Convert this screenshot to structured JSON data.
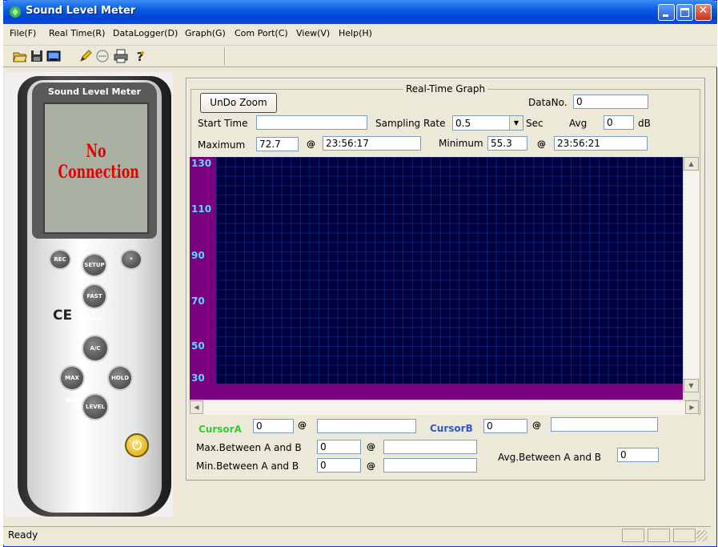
{
  "window": {
    "title": "Sound Level Meter"
  },
  "menu": [
    "File(F)",
    "Real Time(R)",
    "DataLogger(D)",
    "Graph(G)",
    "Com Port(C)",
    "View(V)",
    "Help(H)"
  ],
  "toolbar": {
    "icons": [
      "open-folder-icon",
      "save-icon",
      "monitor-icon",
      "pencil-icon",
      "circle-icon",
      "print-icon",
      "help-icon"
    ]
  },
  "device": {
    "label": "Sound Level Meter",
    "status": "No Connection",
    "buttons": {
      "rec": "REC",
      "setup": "SETUP",
      "light": "*",
      "fastslow": "FAST SLOW",
      "ac": "A/C",
      "maxmin": "MAX MIN",
      "hold": "HOLD",
      "level": "LEVEL"
    },
    "ce": "CE"
  },
  "graph": {
    "title": "Real-Time Graph",
    "undo_zoom": "UnDo Zoom",
    "datano_label": "DataNo.",
    "datano": "0",
    "start_time_label": "Start Time",
    "start_time": "",
    "sampling_label": "Sampling Rate",
    "sampling": "0.5",
    "sec_label": "Sec",
    "avg_label": "Avg",
    "avg": "0",
    "db_label": "dB",
    "maximum_label": "Maximum",
    "maximum": "72.7",
    "max_time": "23:56:17",
    "minimum_label": "Minimum",
    "minimum": "55.3",
    "min_time": "23:56:21",
    "at": "@",
    "yticks": [
      "130",
      "110",
      "90",
      "70",
      "50",
      "30"
    ]
  },
  "cursors": {
    "a_label": "CursorA",
    "a_value": "0",
    "a_time": "",
    "b_label": "CursorB",
    "b_value": "0",
    "b_time": "",
    "max_label": "Max.Between A and B",
    "max_value": "0",
    "max_time": "",
    "min_label": "Min.Between A and B",
    "min_value": "0",
    "min_time": "",
    "avg_label": "Avg.Between A and B",
    "avg_value": "0",
    "a_color": "#33cc33",
    "b_color": "#3355cc"
  },
  "status": {
    "text": "Ready"
  }
}
